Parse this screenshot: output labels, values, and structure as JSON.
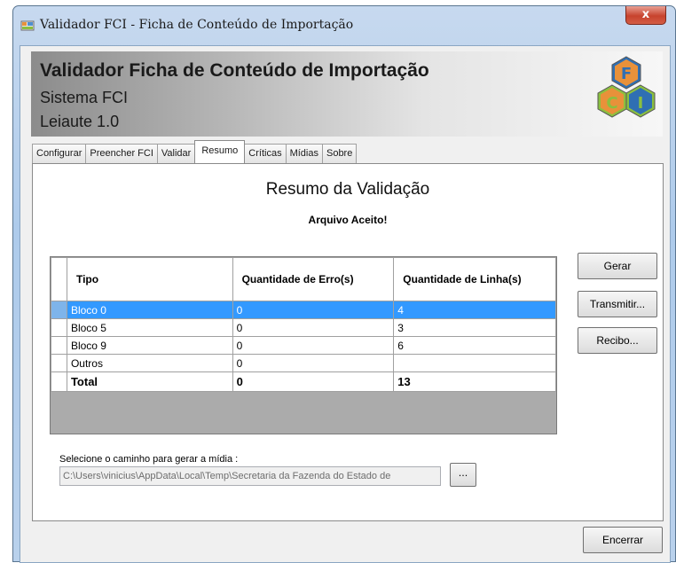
{
  "window": {
    "title": "Validador FCI - Ficha de Conteúdo de Importação",
    "close_label": "x"
  },
  "header": {
    "title": "Validador Ficha de Conteúdo de Importação",
    "subtitle1": "Sistema FCI",
    "subtitle2": "Leiaute 1.0",
    "logo_letters": [
      "F",
      "C",
      "I"
    ]
  },
  "tabs": [
    {
      "label": "Configurar"
    },
    {
      "label": "Preencher FCI"
    },
    {
      "label": "Validar"
    },
    {
      "label": "Resumo",
      "active": true
    },
    {
      "label": "Críticas"
    },
    {
      "label": "Mídias"
    },
    {
      "label": "Sobre"
    }
  ],
  "panel": {
    "title": "Resumo da Validação",
    "status": "Arquivo Aceito!"
  },
  "grid": {
    "columns": [
      "Tipo",
      "Quantidade de Erro(s)",
      "Quantidade de Linha(s)"
    ],
    "rows": [
      {
        "tipo": "Bloco 0",
        "erros": "0",
        "linhas": "4",
        "selected": true
      },
      {
        "tipo": "Bloco 5",
        "erros": "0",
        "linhas": "3"
      },
      {
        "tipo": "Bloco 9",
        "erros": "0",
        "linhas": "6"
      },
      {
        "tipo": "Outros",
        "erros": "0",
        "linhas": ""
      }
    ],
    "total": {
      "tipo": "Total",
      "erros": "0",
      "linhas": "13"
    }
  },
  "buttons": {
    "gerar": "Gerar",
    "transmitir": "Transmitir...",
    "recibo": "Recibo...",
    "browse": "...",
    "encerrar": "Encerrar"
  },
  "path": {
    "label": "Selecione o caminho para gerar a mídia :",
    "value": "C:\\Users\\vinicius\\AppData\\Local\\Temp\\Secretaria da Fazenda do Estado de"
  },
  "colors": {
    "selection": "#3399ff",
    "logo_hex_orange": "#e8913a",
    "logo_hex_green": "#8bbf3f",
    "logo_hex_blue": "#2f6fb3"
  }
}
